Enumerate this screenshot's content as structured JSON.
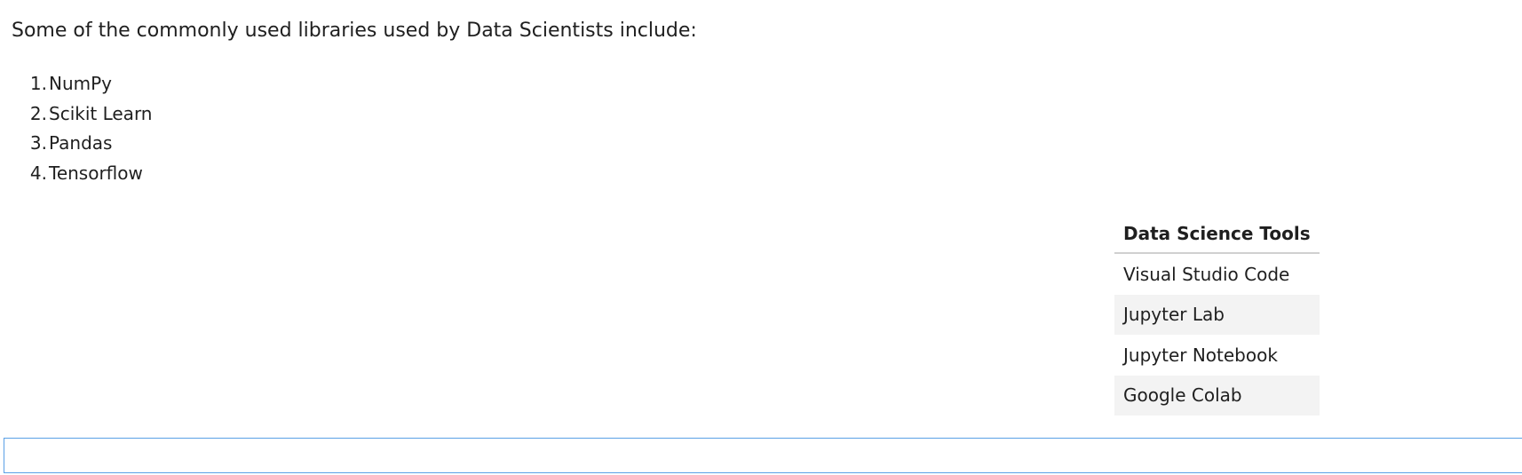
{
  "intro": "Some of the commonly used libraries used by Data Scientists include:",
  "libraries": [
    {
      "num": "1.",
      "label": "NumPy"
    },
    {
      "num": "2.",
      "label": "Scikit Learn"
    },
    {
      "num": "3.",
      "label": "Pandas"
    },
    {
      "num": "4.",
      "label": "Tensorflow"
    }
  ],
  "table": {
    "header": "Data Science Tools",
    "rows": [
      "Visual Studio Code",
      "Jupyter Lab",
      "Jupyter Notebook",
      "Google Colab"
    ]
  },
  "colors": {
    "text": "#1f1f1f",
    "row_alt": "#f3f3f3",
    "cell_border": "#5aa0e6"
  }
}
